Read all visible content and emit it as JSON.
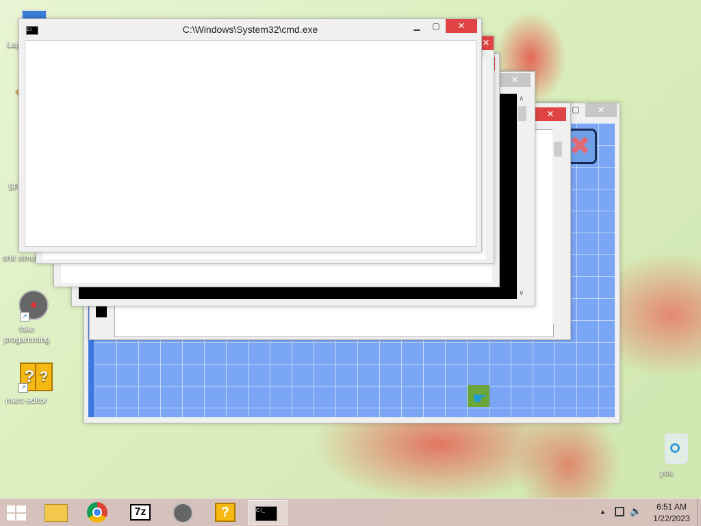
{
  "desktop": {
    "icons": [
      {
        "label": "Lap"
      },
      {
        "label": ""
      },
      {
        "label": "SP"
      },
      {
        "label": "shit simul"
      },
      {
        "label": "fake progamming"
      },
      {
        "label": "maro editor"
      },
      {
        "label": "you"
      }
    ]
  },
  "windows": {
    "front": {
      "title": "C:\\Windows\\System32\\cmd.exe",
      "close_glyph": "✕",
      "min_glyph": "▁",
      "max_glyph": "▢"
    },
    "glyphs": {
      "close": "✕",
      "scroll_up": "∧",
      "scroll_down": "∨"
    }
  },
  "taskbar": {
    "apps": [
      "start",
      "file-explorer",
      "chrome",
      "7zip",
      "fake-progamming",
      "maro-editor",
      "cmd"
    ],
    "sevenzip_label": "7z",
    "clock_time": "6:51 AM",
    "clock_date": "1/22/2023",
    "tray_arrow": "▲"
  },
  "colors": {
    "close_red": "#e04343",
    "grid_blue": "#7aa6f5",
    "taskbar": "#d6bebc"
  }
}
